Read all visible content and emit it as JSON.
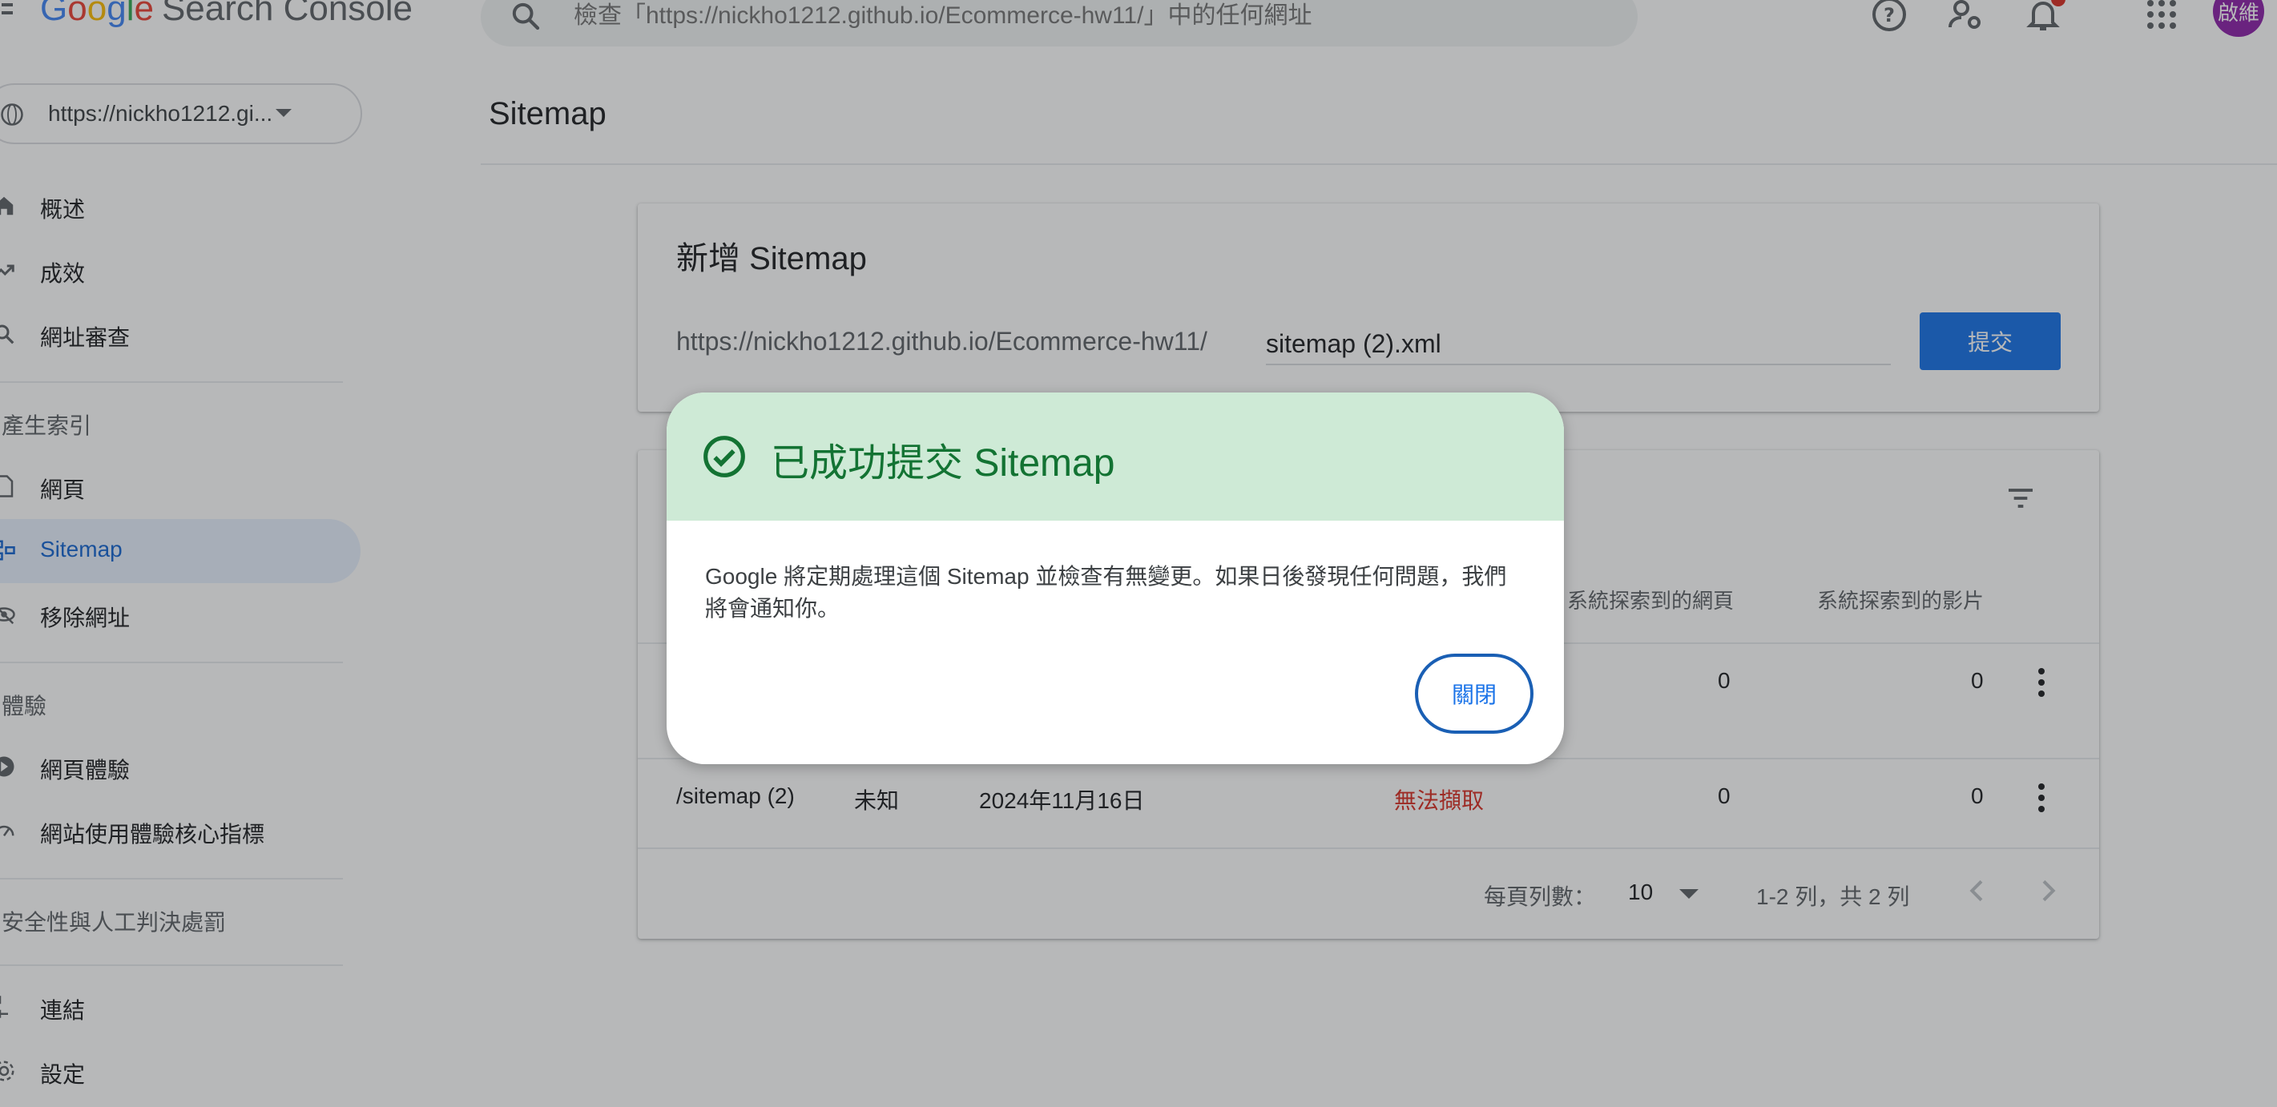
{
  "header": {
    "logo_google": "Google",
    "logo_product": "Search Console",
    "search_placeholder": "檢查「https://nickho1212.github.io/Ecommerce-hw11/」中的任何網址",
    "avatar_text": "啟維",
    "icons": [
      "menu-icon",
      "search-icon",
      "help-icon",
      "user-settings-icon",
      "notifications-icon",
      "apps-icon"
    ]
  },
  "sidebar": {
    "property": "https://nickho1212.gi...",
    "items": [
      {
        "label": "概述",
        "icon": "home-icon"
      },
      {
        "label": "成效",
        "icon": "trending-up-icon"
      },
      {
        "label": "網址審查",
        "icon": "search-icon"
      }
    ],
    "sections": [
      {
        "label": "產生索引",
        "items": [
          {
            "label": "網頁",
            "icon": "page-icon"
          },
          {
            "label": "Sitemap",
            "icon": "sitemap-icon",
            "active": true
          },
          {
            "label": "移除網址",
            "icon": "visibility-off-icon"
          }
        ]
      },
      {
        "label": "體驗",
        "items": [
          {
            "label": "網頁體驗",
            "icon": "page-experience-icon"
          },
          {
            "label": "網站使用體驗核心指標",
            "icon": "speed-icon"
          }
        ]
      },
      {
        "label": "安全性與人工判決處罰",
        "items": []
      }
    ],
    "bottom_items": [
      {
        "label": "連結",
        "icon": "links-icon"
      },
      {
        "label": "設定",
        "icon": "settings-icon"
      }
    ]
  },
  "main": {
    "page_title": "Sitemap",
    "add_sitemap": {
      "title": "新增 Sitemap",
      "url_prefix": "https://nickho1212.github.io/Ecommerce-hw11/",
      "input_value": "sitemap (2).xml",
      "submit_label": "提交"
    },
    "table": {
      "columns_visible": [
        "系統探索到的網頁",
        "系統探索到的影片"
      ],
      "rows": [
        {
          "sitemap": "",
          "type": "",
          "submitted": "",
          "status": "",
          "pages": "0",
          "videos": "0"
        },
        {
          "sitemap": "/sitemap (2)",
          "type": "未知",
          "submitted": "2024年11月16日",
          "status": "無法擷取",
          "pages": "0",
          "videos": "0"
        }
      ],
      "pagination": {
        "rows_per_page_label": "每頁列數：",
        "rows_per_page": "10",
        "range_text": "1-2 列，共 2 列"
      }
    }
  },
  "dialog": {
    "title": "已成功提交 Sitemap",
    "body": "Google 將定期處理這個 Sitemap 並檢查有無變更。如果日後發現任何問題，我們將會通知你。",
    "close_label": "關閉",
    "icon": "check-circle-icon",
    "header_color": "#ceead6",
    "accent_color": "#137333"
  },
  "colors": {
    "primary": "#1a73e8",
    "error": "#d93025",
    "active_nav_bg": "#e8f0fe"
  }
}
